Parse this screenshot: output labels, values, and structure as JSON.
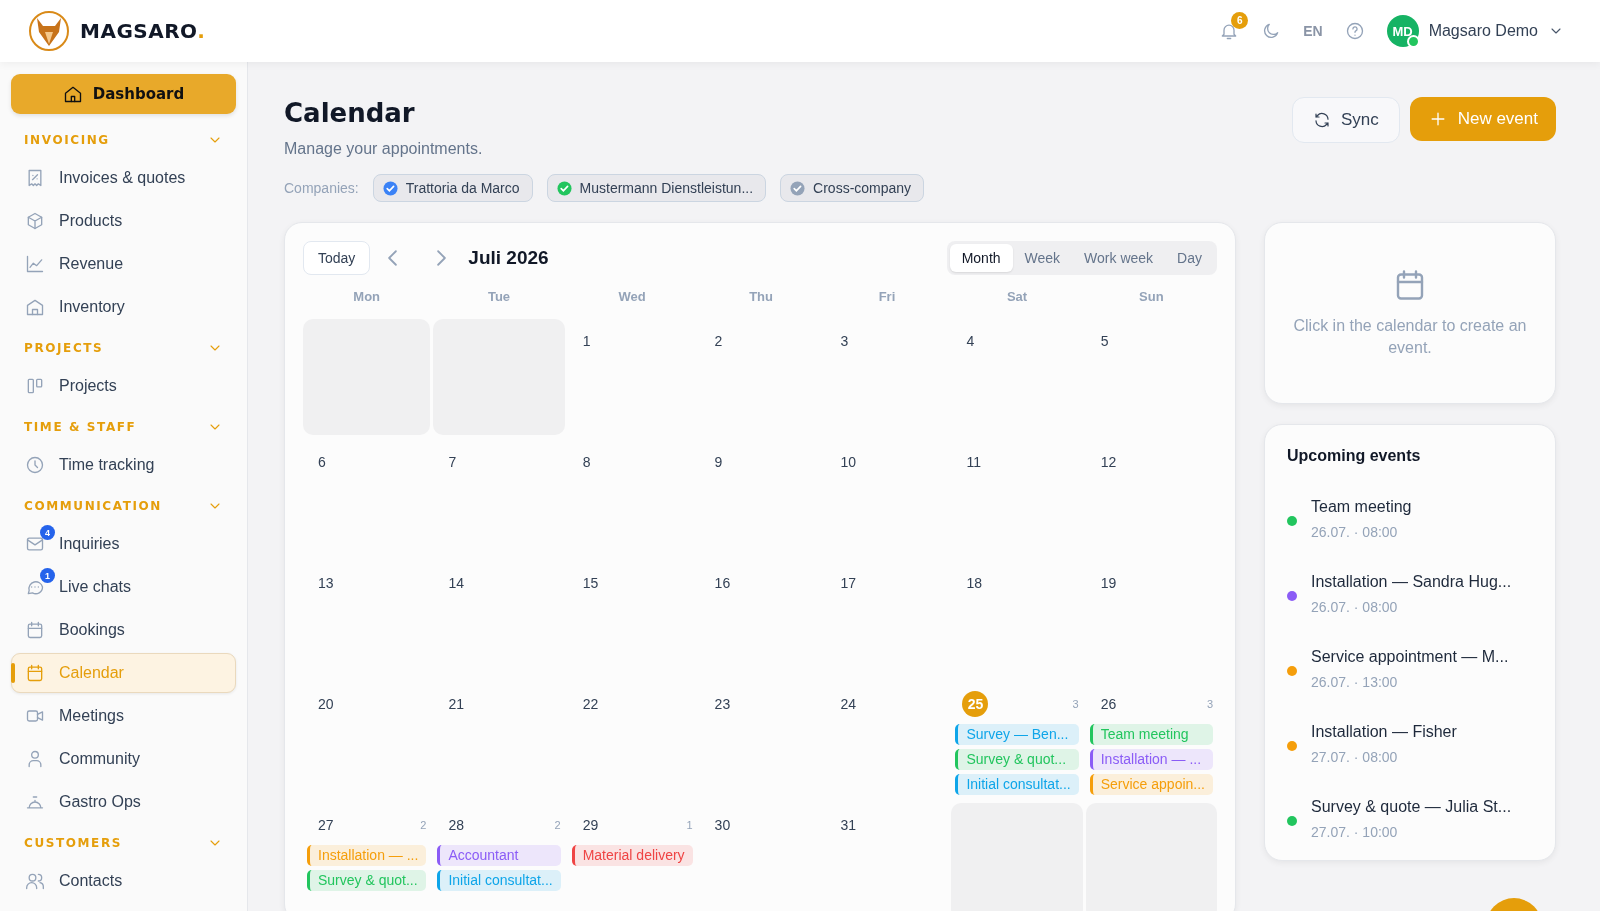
{
  "header": {
    "brand": "MAGSARO",
    "brand_mark": ".",
    "notifications": "6",
    "language": "EN",
    "avatar": "MD",
    "online": true,
    "user": "Magsaro Demo"
  },
  "sidebar": {
    "dashboard": "Dashboard",
    "sections": [
      {
        "title": "INVOICING",
        "expanded": true,
        "items": [
          {
            "label": "Invoices & quotes",
            "selected": false
          },
          {
            "label": "Products",
            "selected": false
          },
          {
            "label": "Revenue",
            "selected": false
          },
          {
            "label": "Inventory",
            "selected": false
          }
        ]
      },
      {
        "title": "PROJECTS",
        "expanded": true,
        "items": [
          {
            "label": "Projects",
            "selected": false
          }
        ]
      },
      {
        "title": "TIME & STAFF",
        "expanded": true,
        "items": [
          {
            "label": "Time tracking",
            "selected": false
          }
        ]
      },
      {
        "title": "COMMUNICATION",
        "expanded": true,
        "items": [
          {
            "label": "Inquiries",
            "badge": "4",
            "selected": false
          },
          {
            "label": "Live chats",
            "badge": "1",
            "selected": false
          },
          {
            "label": "Bookings",
            "selected": false
          },
          {
            "label": "Calendar",
            "selected": true
          },
          {
            "label": "Meetings",
            "selected": false
          },
          {
            "label": "Community",
            "selected": false
          },
          {
            "label": "Gastro Ops",
            "selected": false
          }
        ]
      },
      {
        "title": "CUSTOMERS",
        "expanded": true,
        "items": [
          {
            "label": "Contacts",
            "selected": false
          }
        ]
      }
    ]
  },
  "page": {
    "title": "Calendar",
    "subtitle": "Manage your appointments.",
    "companies_label": "Companies:",
    "companies": [
      {
        "name": "Trattoria da Marco",
        "color": "#3b82f6"
      },
      {
        "name": "Mustermann Dienstleistun...",
        "color": "#22c55e"
      },
      {
        "name": "Cross-company",
        "color": "#94a3b8"
      }
    ],
    "sync": "Sync",
    "new_event": "New event"
  },
  "calendar": {
    "today": "Today",
    "month": "Juli 2026",
    "views": [
      {
        "label": "Month",
        "selected": true
      },
      {
        "label": "Week",
        "selected": false
      },
      {
        "label": "Work week",
        "selected": false
      },
      {
        "label": "Day",
        "selected": false
      }
    ],
    "weekdays": [
      "Mon",
      "Tue",
      "Wed",
      "Thu",
      "Fri",
      "Sat",
      "Sun"
    ],
    "weeks": [
      {
        "days": [
          {
            "outside": true
          },
          {
            "outside": true
          },
          {
            "outside": false,
            "day": "1",
            "today": false
          },
          {
            "outside": false,
            "day": "2",
            "today": false
          },
          {
            "outside": false,
            "day": "3",
            "today": false
          },
          {
            "outside": false,
            "day": "4",
            "today": false
          },
          {
            "outside": false,
            "day": "5",
            "today": false
          }
        ]
      },
      {
        "days": [
          {
            "outside": false,
            "day": "6",
            "today": false
          },
          {
            "outside": false,
            "day": "7",
            "today": false
          },
          {
            "outside": false,
            "day": "8",
            "today": false
          },
          {
            "outside": false,
            "day": "9",
            "today": false
          },
          {
            "outside": false,
            "day": "10",
            "today": false
          },
          {
            "outside": false,
            "day": "11",
            "today": false
          },
          {
            "outside": false,
            "day": "12",
            "today": false
          }
        ]
      },
      {
        "days": [
          {
            "outside": false,
            "day": "13",
            "today": false
          },
          {
            "outside": false,
            "day": "14",
            "today": false
          },
          {
            "outside": false,
            "day": "15",
            "today": false
          },
          {
            "outside": false,
            "day": "16",
            "today": false
          },
          {
            "outside": false,
            "day": "17",
            "today": false
          },
          {
            "outside": false,
            "day": "18",
            "today": false
          },
          {
            "outside": false,
            "day": "19",
            "today": false
          }
        ]
      },
      {
        "days": [
          {
            "outside": false,
            "day": "20",
            "today": false
          },
          {
            "outside": false,
            "day": "21",
            "today": false
          },
          {
            "outside": false,
            "day": "22",
            "today": false
          },
          {
            "outside": false,
            "day": "23",
            "today": false
          },
          {
            "outside": false,
            "day": "24",
            "today": false
          },
          {
            "outside": false,
            "day": "25",
            "today": true,
            "count": "3",
            "events": [
              {
                "title": "Survey — Ben...",
                "color": "#0ea5e9"
              },
              {
                "title": "Survey & quot...",
                "color": "#22c55e"
              },
              {
                "title": "Initial consultat...",
                "color": "#0ea5e9"
              }
            ]
          },
          {
            "outside": false,
            "day": "26",
            "today": false,
            "count": "3",
            "events": [
              {
                "title": "Team meeting",
                "color": "#22c55e"
              },
              {
                "title": "Installation — ...",
                "color": "#8b5cf6"
              },
              {
                "title": "Service appoin...",
                "color": "#f59e0b"
              }
            ]
          }
        ]
      },
      {
        "days": [
          {
            "outside": false,
            "day": "27",
            "today": false,
            "count": "2",
            "events": [
              {
                "title": "Installation — ...",
                "color": "#f59e0b"
              },
              {
                "title": "Survey & quot...",
                "color": "#22c55e"
              }
            ]
          },
          {
            "outside": false,
            "day": "28",
            "today": false,
            "count": "2",
            "events": [
              {
                "title": "Accountant",
                "color": "#8b5cf6"
              },
              {
                "title": "Initial consultat...",
                "color": "#0ea5e9"
              }
            ]
          },
          {
            "outside": false,
            "day": "29",
            "today": false,
            "count": "1",
            "events": [
              {
                "title": "Material delivery",
                "color": "#ef4444"
              }
            ]
          },
          {
            "outside": false,
            "day": "30",
            "today": false
          },
          {
            "outside": false,
            "day": "31",
            "today": false
          },
          {
            "outside": true
          },
          {
            "outside": true
          }
        ]
      }
    ]
  },
  "hint": "Click in the calendar to create an event.",
  "upcoming": {
    "title": "Upcoming events",
    "events": [
      {
        "title": "Team meeting",
        "time": "26.07. · 08:00",
        "color": "#22c55e"
      },
      {
        "title": "Installation — Sandra Hug...",
        "time": "26.07. · 08:00",
        "color": "#8b5cf6"
      },
      {
        "title": "Service appointment — M...",
        "time": "26.07. · 13:00",
        "color": "#f59e0b"
      },
      {
        "title": "Installation — Fisher",
        "time": "27.07. · 08:00",
        "color": "#f59e0b"
      },
      {
        "title": "Survey & quote — Julia St...",
        "time": "27.07. · 10:00",
        "color": "#22c55e"
      }
    ]
  }
}
